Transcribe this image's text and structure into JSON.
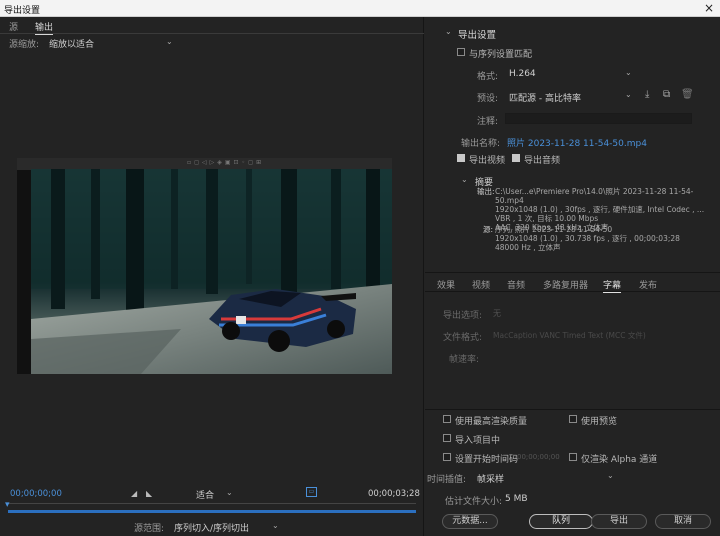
{
  "window": {
    "title": "导出设置",
    "close": "×"
  },
  "left": {
    "tabs": [
      "源",
      "输出"
    ],
    "source_scaling_label": "源缩放:",
    "source_scaling_value": "缩放以适合",
    "start_time": "00;00;00;00",
    "end_time": "00;00;03;28",
    "fit_value": "适合",
    "source_range_label": "源范围:",
    "source_range_value": "序列切入/序列切出"
  },
  "export_settings": {
    "section_title": "导出设置",
    "match_sequence_label": "与序列设置匹配",
    "format_label": "格式:",
    "format_value": "H.264",
    "preset_label": "预设:",
    "preset_value": "匹配源 - 高比特率",
    "comments_label": "注释:",
    "output_name_label": "输出名称:",
    "output_name_value": "照片 2023-11-28 11-54-50.mp4",
    "export_video_label": "导出视频",
    "export_audio_label": "导出音频",
    "summary_title": "摘要",
    "summary_output_label": "输出:",
    "summary_output_lines": [
      "C:\\User...e\\Premiere Pro\\14.0\\照片 2023-11-28 11-54-50.mp4",
      "1920x1048 (1.0) , 30fps , 逐行, 硬件加速, Intel Codec ,  ...",
      "VBR , 1 次, 目标 10.00 Mbps",
      "AAC, 320 Kbps, 48 kHz, 立体声"
    ],
    "summary_source_label": "源:",
    "summary_source_lines": [
      "序列, 照片 2023-11-28 11-54-50",
      "1920x1048 (1.0) , 30.738 fps , 逐行 , 00;00;03;28",
      "48000 Hz , 立体声"
    ]
  },
  "tabs": [
    "效果",
    "视频",
    "音频",
    "多路复用器",
    "字幕",
    "发布"
  ],
  "active_tab": "字幕",
  "captions": {
    "export_option_label": "导出选项:",
    "export_option_value": "无",
    "file_format_label": "文件格式:",
    "file_format_value": "MacCaption VANC Timed Text (MCC 文件)",
    "frame_rate_label": "帧速率:"
  },
  "bottom": {
    "max_render_quality_label": "使用最高渲染质量",
    "use_previews_label": "使用预览",
    "import_project_label": "导入项目中",
    "set_start_timecode_label": "设置开始时间码",
    "start_timecode_value": "00;00;00;00",
    "render_alpha_label": "仅渲染 Alpha 通道",
    "time_interp_label": "时间插值:",
    "time_interp_value": "帧采样",
    "est_size_label": "估计文件大小:",
    "est_size_value": "5 MB",
    "metadata_button": "元数据...",
    "queue_button": "队列",
    "export_button": "导出",
    "cancel_button": "取消"
  }
}
